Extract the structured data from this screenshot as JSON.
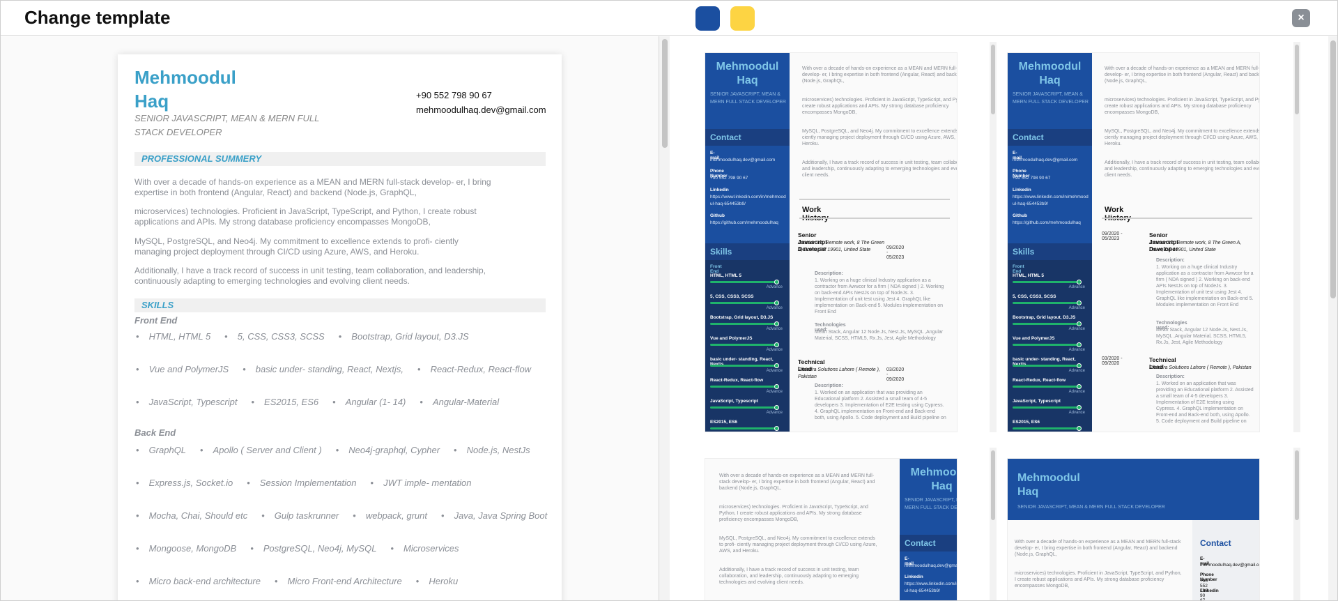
{
  "header": {
    "title": "Change template",
    "swatches": [
      {
        "name": "blue",
        "color": "#1b4fa0"
      },
      {
        "name": "yellow",
        "color": "#fdd443"
      }
    ],
    "close_label": "×"
  },
  "resume": {
    "name": "Mehmoodul\nHaq",
    "role": "SENIOR JAVASCRIPT, MEAN & MERN FULL STACK DEVELOPER",
    "phone": "+90 552 798 90 67",
    "email": "mehmoodulhaq.dev@gmail.com",
    "summary_heading": "PROFESSIONAL SUMMERY",
    "summary": [
      "With over a decade of hands-on experience as a MEAN and MERN full-stack develop- er, I bring expertise in both frontend (Angular, React) and backend (Node.js, GraphQL,",
      "microservices) technologies. Proficient in JavaScript, TypeScript, and Python, I create robust applications and APIs. My strong database proficiency encompasses MongoDB,",
      "MySQL, PostgreSQL, and Neo4j. My commitment to excellence extends to profi- ciently managing project deployment through CI/CD using Azure, AWS, and Heroku.",
      "Additionally, I have a track record of success in unit testing, team collaboration, and leadership, continuously adapting to emerging technologies and evolving client needs."
    ],
    "skills_heading": "SKILLS",
    "front_end_label": "Front End",
    "front_end_rows": [
      [
        "HTML, HTML 5",
        "5, CSS, CSS3, SCSS",
        "Bootstrap, Grid layout, D3.JS"
      ],
      [
        "Vue and PolymerJS",
        "basic under- standing, React, Nextjs,",
        "React-Redux, React-flow"
      ],
      [
        "JavaScript, Typescript",
        "ES2015, ES6",
        "Angular (1- 14)",
        "Angular-Material"
      ]
    ],
    "back_end_label": "Back End",
    "back_end_rows": [
      [
        "GraphQL",
        "Apollo ( Server and Client )",
        "Neo4j-graphql, Cypher",
        "Node.js, NestJs"
      ],
      [
        "Express.js, Socket.io",
        "Session Implementation",
        "JWT imple- mentation"
      ],
      [
        "Mocha, Chai, Should etc",
        "Gulp taskrunner",
        "webpack, grunt",
        "Java, Java Spring Boot"
      ],
      [
        "Mongoose, MongoDB",
        "PostgreSQL, Neo4j, MySQL",
        "Microservices"
      ],
      [
        "Micro back-end architecture",
        "Micro Front-end Architecture",
        "Heroku"
      ]
    ]
  },
  "mini": {
    "name": "Mehmoodul\nHaq",
    "role": "SENIOR JAVASCRIPT, MEAN & MERN FULL STACK DEVELOPER",
    "contact_heading": "Contact",
    "email_label": "E-mail",
    "email": "mehmoodulhaq.dev@gmail.com",
    "phone_label": "Phone Number",
    "phone": "+90 552 798 90 67",
    "linkedin_label": "Linkedin",
    "linkedin": "https://www.linkedin.com/in/mehmoodul-haq-654453b9/",
    "github_label": "Github",
    "github": "https://github.com/mehmoodulhaq",
    "skills_heading": "Skills",
    "front_end_label": "Front End",
    "skills": [
      "HTML, HTML 5",
      "5, CSS, CSS3, SCSS",
      "Bootstrap, Grid layout, D3.JS",
      "Vue and PolymerJS",
      "basic under- standing, React, Nextjs,",
      "React-Redux, React-flow",
      "JavaScript, Typescript",
      "ES2015, ES6"
    ],
    "level": "Advance",
    "summary": [
      "With over a decade of hands-on experience as a MEAN and MERN full-stack develop- er, I bring expertise in both frontend (Angular, React) and backend (Node.js, GraphQL,",
      "microservices) technologies. Proficient in JavaScript, TypeScript, and Python, I create robust applications and APIs. My strong database proficiency encompasses MongoDB,",
      "MySQL, PostgreSQL, and Neo4j. My commitment to excellence extends to profi- ciently managing project deployment through CI/CD using Azure, AWS, and Heroku.",
      "Additionally, I have a track record of success in unit testing, team collaboration, and leadership, continuously adapting to emerging technologies and evolving client needs."
    ],
    "work_heading": "Work History",
    "jobs": [
      {
        "title": "Senior Javascript Developer",
        "company": "Awwcor Inc, Remote work, 8 The Green A, Dover, DE 19901, United State",
        "dates": "09/2020 - 05/2023",
        "desc_label": "Description:",
        "desc": "1. Working on a huge clinical Industry application as a contractor from Awwcor for a firm ( NDA signed ) 2. Working on back-end APIs NestJs on top of NodeJs. 3. Implementation of unit test using Jest 4. GraphQL like implementation on Back-end 5. Modules implementation on Front End",
        "tech_label": "Technologies used:",
        "tech": "Mean Stack, Angular 12 Node.Js, Nest.Js, MySQL ,Angular Material, SCSS, HTML5, Rx.Js, Jest, Agile Methodology"
      },
      {
        "title": "Technical Lead",
        "company": "Phaedra Solutions Lahore ( Remote ), Pakistan",
        "dates": "03/2020 - 09/2020",
        "desc_label": "Description:",
        "desc": "1. Worked on an application that was providing an Educational platform 2. Assisted a small team of 4-5 developers 3. Implementation of E2E testing using Cypress. 4. GraphQL implementation on Front-end and Back-end both, using Apollo. 5. Code deployment and Build pipeline on"
      }
    ]
  }
}
